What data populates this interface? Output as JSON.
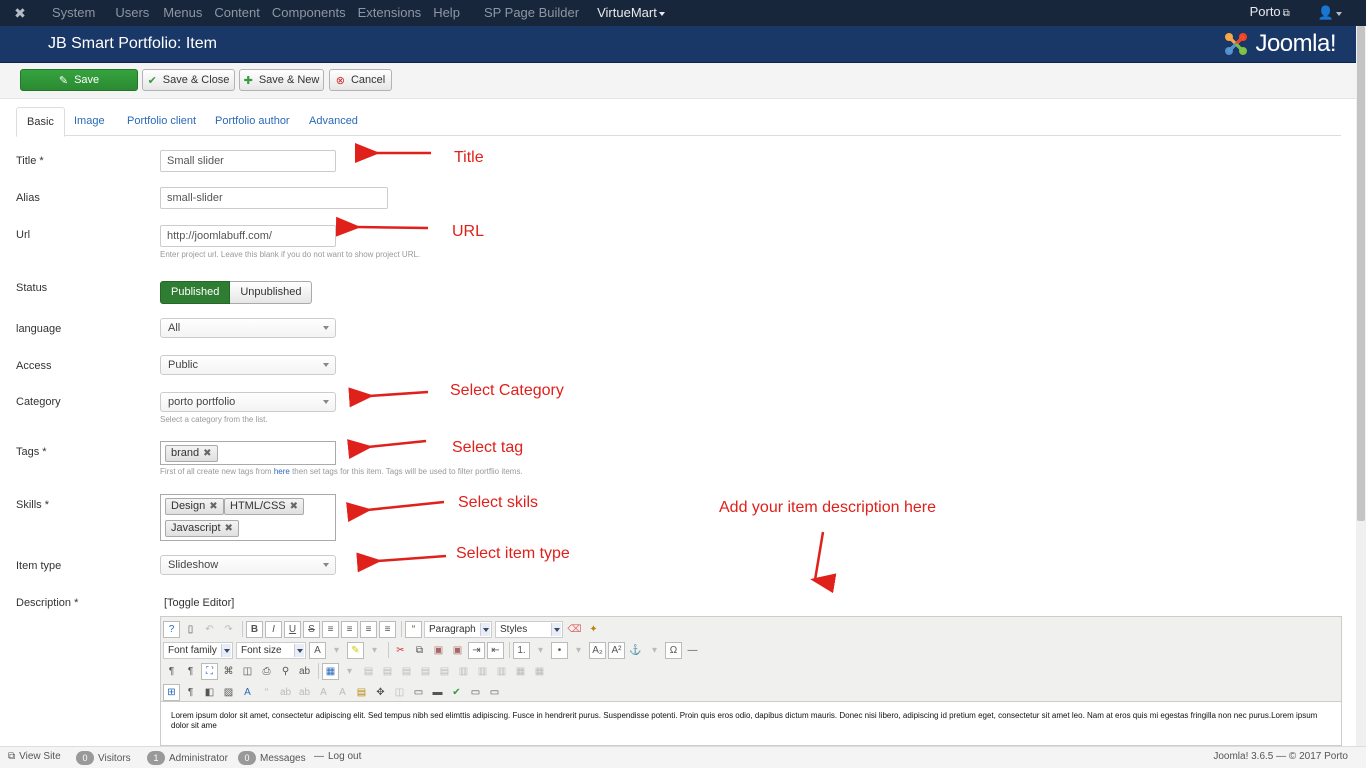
{
  "navbar": {
    "menu": [
      "System",
      "Users",
      "Menus",
      "Content",
      "Components",
      "Extensions",
      "Help",
      "SP Page Builder",
      "VirtueMart"
    ],
    "user": "Porto"
  },
  "header": {
    "title": "JB Smart Portfolio: Item",
    "logo_text": "Joomla!"
  },
  "toolbar": {
    "save": "Save",
    "save_close": "Save & Close",
    "save_new": "Save & New",
    "cancel": "Cancel"
  },
  "tabs": [
    "Basic",
    "Image",
    "Portfolio client",
    "Portfolio author",
    "Advanced"
  ],
  "form": {
    "title_label": "Title *",
    "title_value": "Small slider",
    "alias_label": "Alias",
    "alias_value": "small-slider",
    "url_label": "Url",
    "url_value": "http://joomlabuff.com/",
    "url_help": "Enter project url. Leave this blank if you do not want to show project URL.",
    "status_label": "Status",
    "status_published": "Published",
    "status_unpublished": "Unpublished",
    "language_label": "language",
    "language_value": "All",
    "access_label": "Access",
    "access_value": "Public",
    "category_label": "Category",
    "category_value": "porto portfolio",
    "category_help": "Select a category from the list.",
    "tags_label": "Tags *",
    "tags": [
      "brand"
    ],
    "tags_help_pre": "First of all create new tags from ",
    "tags_help_link": "here",
    "tags_help_post": " then set tags for this item. Tags will be used to filter portflio items.",
    "skills_label": "Skills *",
    "skills": [
      "Design",
      "HTML/CSS",
      "Javascript"
    ],
    "itemtype_label": "Item type",
    "itemtype_value": "Slideshow",
    "description_label": "Description *",
    "toggle_editor": "[Toggle Editor]"
  },
  "editor": {
    "format_select": "Paragraph",
    "styles_select": "Styles",
    "font_family": "Font family",
    "font_size": "Font size",
    "content": "Lorem ipsum dolor sit amet, consectetur adipiscing elit. Sed tempus nibh sed elimttis adipiscing. Fusce in hendrerit purus. Suspendisse potenti. Proin quis eros odio, dapibus dictum mauris. Donec nisi libero, adipiscing id pretium eget, consectetur sit amet leo. Nam at eros quis mi egestas fringilla non nec purus.Lorem ipsum dolor sit ame"
  },
  "annotations": {
    "title": "Title",
    "url": "URL",
    "category": "Select Category",
    "tag": "Select tag",
    "skills": "Select skils",
    "item_type": "Select item type",
    "description": "Add your item description here",
    "color": "#e0201a"
  },
  "statusbar": {
    "view_site": "View Site",
    "visitors_count": "0",
    "visitors": "Visitors",
    "admin_count": "1",
    "admin": "Administrator",
    "messages_count": "0",
    "messages": "Messages",
    "logout": "Log out",
    "version": "Joomla! 3.6.5 — © 2017 Porto"
  }
}
